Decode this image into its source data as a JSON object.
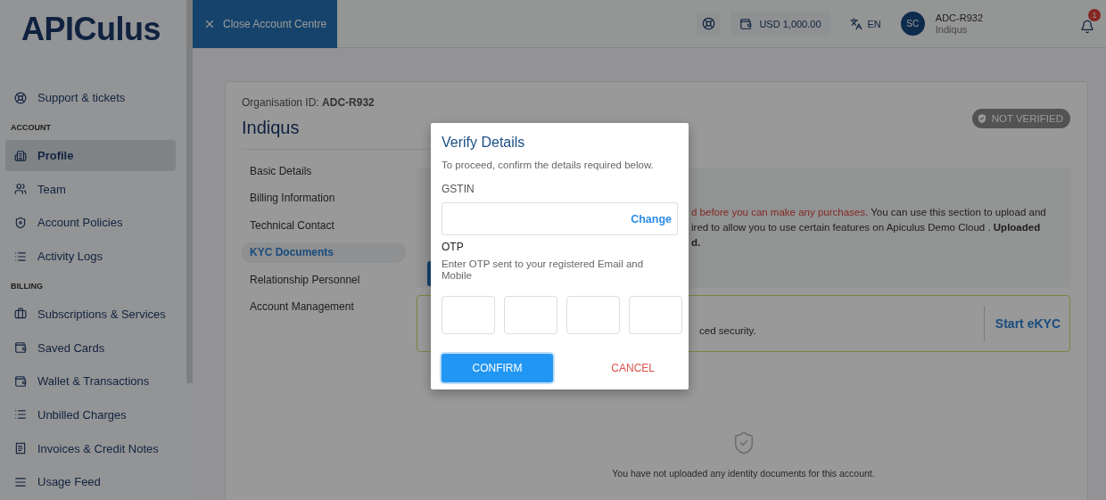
{
  "sidebar": {
    "logo": "APICulus",
    "items": [
      {
        "kind": "link",
        "label": "Support & tickets",
        "selected": false
      },
      {
        "kind": "header",
        "label": "ACCOUNT"
      },
      {
        "kind": "link",
        "label": "Profile",
        "selected": true
      },
      {
        "kind": "link",
        "label": "Team",
        "selected": false
      },
      {
        "kind": "link",
        "label": "Account Policies",
        "selected": false
      },
      {
        "kind": "link",
        "label": "Activity Logs",
        "selected": false
      },
      {
        "kind": "header",
        "label": "BILLING"
      },
      {
        "kind": "link",
        "label": "Subscriptions & Services",
        "selected": false
      },
      {
        "kind": "link",
        "label": "Saved Cards",
        "selected": false
      },
      {
        "kind": "link",
        "label": "Wallet & Transactions",
        "selected": false
      },
      {
        "kind": "link",
        "label": "Unbilled Charges",
        "selected": false
      },
      {
        "kind": "link",
        "label": "Invoices & Credit Notes",
        "selected": false
      },
      {
        "kind": "link",
        "label": "Usage Feed",
        "selected": false
      }
    ]
  },
  "topbar": {
    "close_button": "Close Account Centre",
    "balance": "USD 1,000.00",
    "language": "EN",
    "avatar": "SC",
    "user_id": "ADC-R932",
    "user_org": "Indiqus",
    "notifications": "1"
  },
  "card": {
    "org_id_label": "Organisation ID:",
    "org_id": "ADC-R932",
    "org_name": "Indiqus",
    "status": "NOT VERIFIED",
    "nav": [
      {
        "label": "Basic Details",
        "selected": false
      },
      {
        "label": "Billing Information",
        "selected": false
      },
      {
        "label": "Technical Contact",
        "selected": false
      },
      {
        "label": "KYC Documents",
        "selected": true
      },
      {
        "label": "Relationship Personnel",
        "selected": false
      },
      {
        "label": "Account Management",
        "selected": false
      }
    ],
    "kyc": {
      "warning": "d before you can make any purchases.",
      "line_1_rest": "You can use this section to upload and",
      "line_2": "ired to allow you to use certain features on Apiculus Demo Cloud . **Uploaded**",
      "line_3": "d.",
      "ekyc_text": "ced security.",
      "ekyc_button": "Start eKYC"
    },
    "empty_message": "You have not uploaded any identity documents for this account."
  },
  "dialog": {
    "title": "Verify Details",
    "subtitle": "To proceed, confirm the details required below.",
    "gstin_label": "GSTIN",
    "change_link": "Change",
    "otp_label": "OTP",
    "otp_hint": "Enter OTP sent to your registered Email and Mobile",
    "confirm": "CONFIRM",
    "cancel": "CANCEL"
  }
}
